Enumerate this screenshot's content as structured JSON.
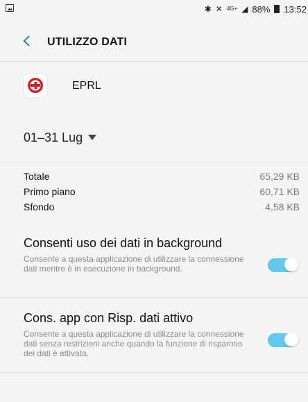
{
  "status_bar": {
    "left_icon": "image-notification-icon",
    "bluetooth_icon": "bluetooth-icon",
    "mute_icon": "vibrate-mute-icon",
    "network": "4G+",
    "battery_percent": "88%",
    "time": "13:52"
  },
  "header": {
    "back_icon": "chevron-left-icon",
    "title": "UTILIZZO DATI"
  },
  "app": {
    "name": "EPRL",
    "icon": "app-logo-icon"
  },
  "date_range": {
    "value": "01–31 Lug",
    "dropdown_icon": "caret-down-icon"
  },
  "usage": [
    {
      "label": "Totale",
      "value": "65,29 KB"
    },
    {
      "label": "Primo piano",
      "value": "60,71 KB"
    },
    {
      "label": "Sfondo",
      "value": "4,58 KB"
    }
  ],
  "settings": [
    {
      "title": "Consenti uso dei dati in background",
      "description": "Consente a questa applicazione di utilizzare la connessione dati mentre è in esecuzione in background.",
      "enabled": true
    },
    {
      "title": "Cons. app con Risp. dati attivo",
      "description": "Consente a questa applicazione di utilizzare la connessione dati senza restrizioni anche quando la funzione di risparmio dei dati è attivata.",
      "enabled": true
    }
  ],
  "colors": {
    "toggle_on": "#62c8ee",
    "brand_red": "#d6232a"
  }
}
